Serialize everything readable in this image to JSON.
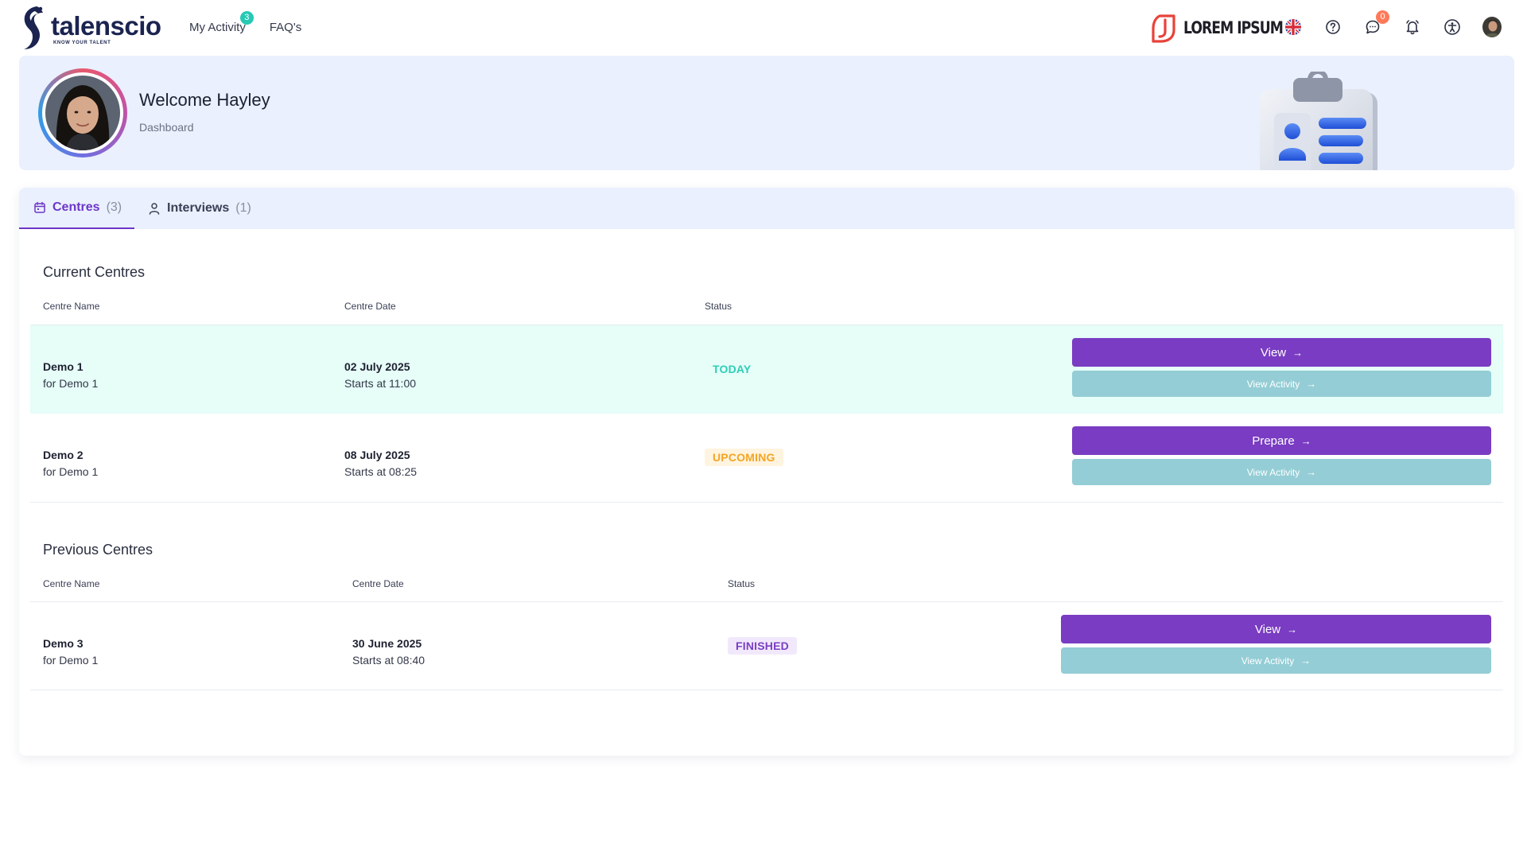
{
  "header": {
    "logo_word": "talenscio",
    "logo_tagline": "KNOW YOUR TALENT",
    "nav": [
      {
        "label": "My Activity",
        "badge": "3"
      },
      {
        "label": "FAQ's"
      }
    ],
    "brand_text": "LOREM IPSUM",
    "messages_badge": "0",
    "icons": [
      "uk-flag-icon",
      "help-icon",
      "messages-icon",
      "bell-icon",
      "accessibility-icon",
      "user-avatar"
    ]
  },
  "banner": {
    "welcome": "Welcome Hayley",
    "subtitle": "Dashboard"
  },
  "tabs": [
    {
      "label": "Centres",
      "count": "(3)",
      "active": true,
      "icon": "calendar-icon"
    },
    {
      "label": "Interviews",
      "count": "(1)",
      "active": false,
      "icon": "person-icon"
    }
  ],
  "current": {
    "title": "Current Centres",
    "columns": [
      "Centre Name",
      "Centre Date",
      "Status"
    ],
    "rows": [
      {
        "name": "Demo 1",
        "for": "for Demo 1",
        "date": "02 July 2025",
        "time": "Starts at 11:00",
        "status": "TODAY",
        "primary": "View",
        "secondary": "View Activity"
      },
      {
        "name": "Demo 2",
        "for": "for Demo 1",
        "date": "08 July 2025",
        "time": "Starts at 08:25",
        "status": "UPCOMING",
        "primary": "Prepare",
        "secondary": "View Activity"
      }
    ]
  },
  "previous": {
    "title": "Previous Centres",
    "columns": [
      "Centre Name",
      "Centre Date",
      "Status"
    ],
    "rows": [
      {
        "name": "Demo 3",
        "for": "for Demo 1",
        "date": "30 June 2025",
        "time": "Starts at 08:40",
        "status": "FINISHED",
        "primary": "View",
        "secondary": "View Activity"
      }
    ]
  },
  "colors": {
    "accent_purple": "#7a3cc2",
    "secondary_teal": "#94cdd5",
    "today": "#2ccfb6",
    "upcoming": "#f4a523",
    "finished": "#7b3fc4",
    "banner_bg": "#eaf0fd"
  }
}
